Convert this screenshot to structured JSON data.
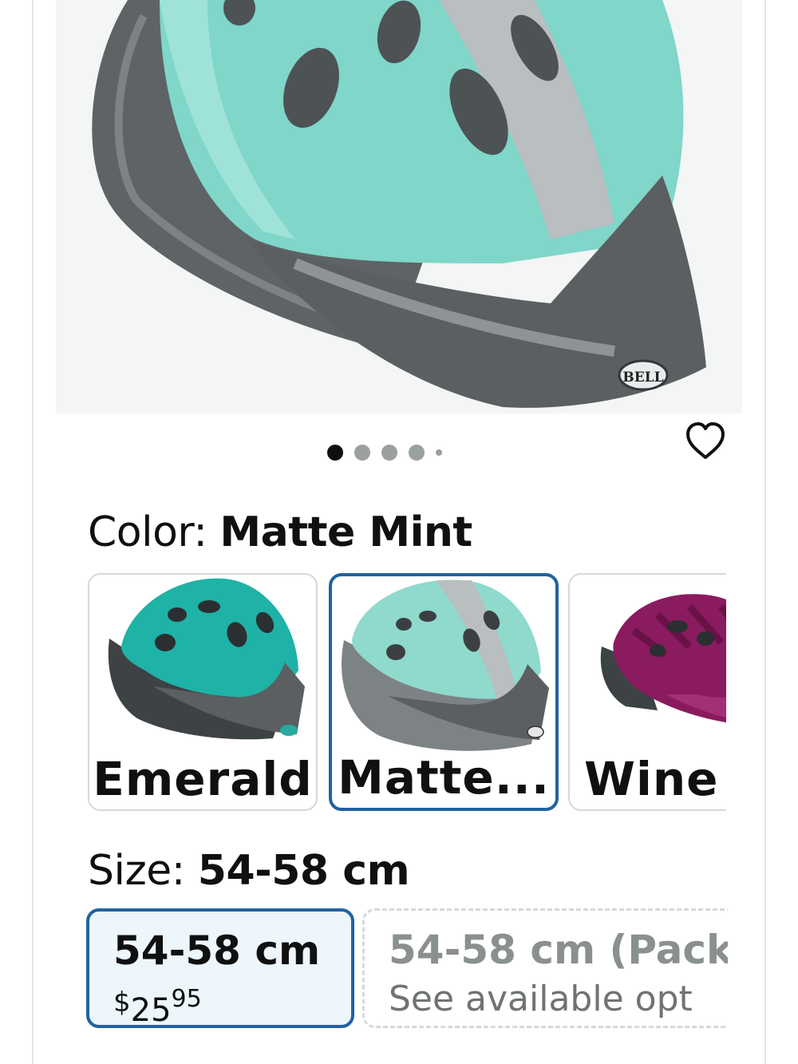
{
  "product": {
    "image_alt": "Bell bike helmet, Matte Mint",
    "brand_badge": "BELL",
    "carousel": {
      "count": 5,
      "active_index": 0
    }
  },
  "color": {
    "label": "Color:",
    "selected": "Matte Mint",
    "options": [
      {
        "name": "Emerald",
        "badge": "BELL"
      },
      {
        "name": "Matte...",
        "badge": "BELL"
      },
      {
        "name": "Wine"
      }
    ]
  },
  "size": {
    "label": "Size:",
    "selected": "54-58 cm",
    "options": [
      {
        "name": "54-58 cm",
        "currency": "$",
        "price_whole": "25",
        "price_fraction": "95"
      },
      {
        "name": "54-58 cm (Pack",
        "subtext": "See available opt"
      }
    ]
  },
  "colors": {
    "selected_border": "#2162a1",
    "selected_bg": "#edf6fb",
    "mint": "#7fd6c9",
    "emerald": "#1fb2a6",
    "wine": "#8a1b5e"
  },
  "icons": {
    "wishlist": "heart-outline-icon"
  }
}
